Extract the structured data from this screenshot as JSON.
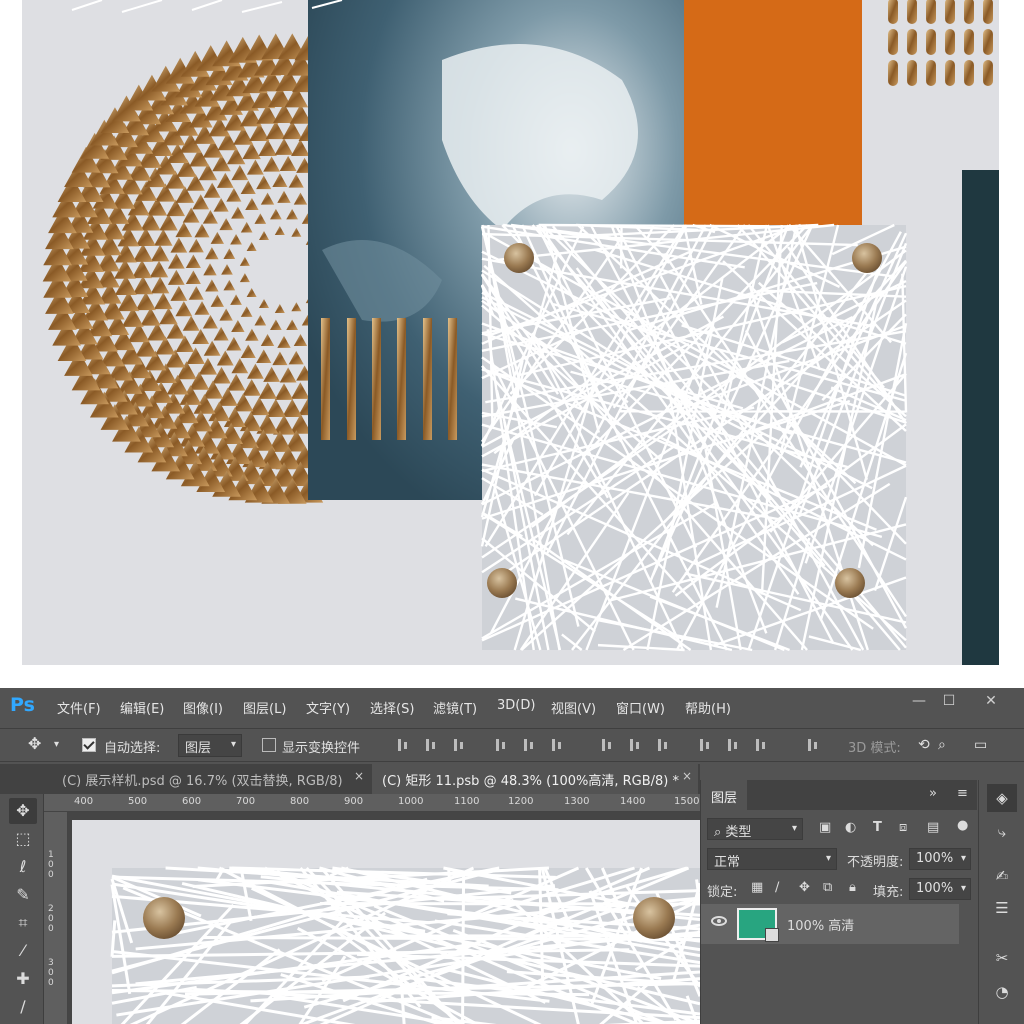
{
  "app": {
    "logo": "Ps"
  },
  "menu": [
    "文件(F)",
    "编辑(E)",
    "图像(I)",
    "图层(L)",
    "文字(Y)",
    "选择(S)",
    "滤镜(T)",
    "3D(D)",
    "视图(V)",
    "窗口(W)",
    "帮助(H)"
  ],
  "window_controls": {
    "minimize": "—",
    "maximize": "☐",
    "close": "✕"
  },
  "options": {
    "auto_select_label": "自动选择:",
    "auto_select_checked": true,
    "auto_select_target": "图层",
    "show_transform_label": "显示变换控件",
    "show_transform_checked": false,
    "mode_3d_label": "3D 模式:"
  },
  "tabs": [
    {
      "label": "(C) 展示样机.psd @ 16.7% (双击替换, RGB/8)",
      "close": "×",
      "active": false
    },
    {
      "label": "(C) 矩形 11.psb @ 48.3% (100%高清, RGB/8) *",
      "close": "×",
      "active": true
    }
  ],
  "ruler": {
    "top": [
      "400",
      "500",
      "600",
      "700",
      "800",
      "900",
      "1000",
      "1100",
      "1200",
      "1300",
      "1400",
      "1500"
    ],
    "left": [
      "100",
      "200",
      "300"
    ]
  },
  "layers_panel": {
    "title": "图层",
    "filter_label": "类型",
    "blend_mode": "正常",
    "opacity_label": "不透明度:",
    "opacity_value": "100%",
    "lock_label": "锁定:",
    "fill_label": "填充:",
    "fill_value": "100%",
    "layers": [
      {
        "name": "100% 高清",
        "thumb_color": "#28a580",
        "visible": true
      }
    ]
  },
  "tools": [
    "move-tool",
    "marquee-tool",
    "lasso-tool",
    "magic-wand-tool",
    "crop-tool",
    "eyedropper-tool",
    "healing-brush-tool",
    "brush-tool"
  ],
  "dock": [
    "layers-icon",
    "paths-icon",
    "brush-settings-icon",
    "adjust-icon",
    "tools-icon",
    "history-icon"
  ],
  "colors": {
    "ps_blue": "#31a8ff",
    "panel_bg": "#535353",
    "orange": "#d56a17",
    "teal": "#3d5f70",
    "gold": "#b07d42"
  }
}
